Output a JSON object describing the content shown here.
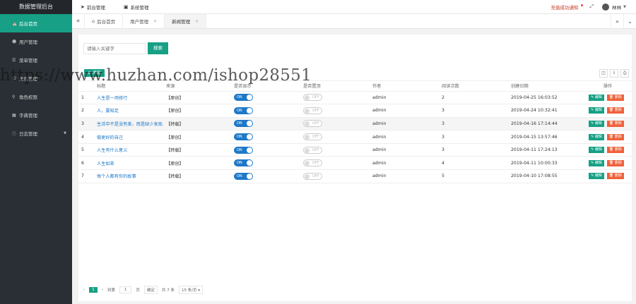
{
  "app": {
    "title": "数据管理后台"
  },
  "sidebar": {
    "items": [
      {
        "icon": "home-icon",
        "label": "后台首页",
        "active": true
      },
      {
        "icon": "users-icon",
        "label": "用户管理"
      },
      {
        "icon": "list-icon",
        "label": "菜单管理"
      },
      {
        "icon": "user-icon",
        "label": "角色管理"
      },
      {
        "icon": "key-icon",
        "label": "角色权限"
      },
      {
        "icon": "grid-icon",
        "label": "字典管理"
      },
      {
        "icon": "info-icon",
        "label": "日志管理",
        "has_caret": true
      }
    ]
  },
  "topbar": {
    "links": [
      {
        "icon": "send-icon",
        "label": "前台管理"
      },
      {
        "icon": "monitor-icon",
        "label": "系统管理"
      }
    ],
    "notice": "充值成功通知",
    "username": "林林"
  },
  "tabs": {
    "items": [
      {
        "label": "后台首页",
        "home": true
      },
      {
        "label": "用户管理"
      },
      {
        "label": "新闻管理",
        "active": true
      }
    ]
  },
  "search": {
    "placeholder": "请输入关键字",
    "button": "搜索"
  },
  "toolbar": {
    "add_label": "添加"
  },
  "table": {
    "headers": [
      "",
      "标题",
      "来源",
      "是否显示",
      "是否置顶",
      "作者",
      "阅读次数",
      "创建日期",
      "操作"
    ],
    "rows": [
      {
        "index": "1",
        "title": "人生是一场修行",
        "source": "【原创】",
        "show": "ON",
        "top": "OFF",
        "author": "admin",
        "views": "2",
        "date": "2019-04-25 16:03:52"
      },
      {
        "index": "2",
        "title": "人，要知足",
        "source": "【原创】",
        "show": "ON",
        "top": "OFF",
        "author": "admin",
        "views": "3",
        "date": "2019-04-24 10:32:41"
      },
      {
        "index": "3",
        "title": "生活中不是没有美，而是缺少发现…",
        "source": "【转载】",
        "show": "ON",
        "top": "OFF",
        "author": "admin",
        "views": "3",
        "date": "2019-04-16 17:14:44"
      },
      {
        "index": "4",
        "title": "做更好的自己",
        "source": "【原创】",
        "show": "ON",
        "top": "OFF",
        "author": "admin",
        "views": "3",
        "date": "2019-04-15 13:57:46"
      },
      {
        "index": "5",
        "title": "人生有什么意义",
        "source": "【转载】",
        "show": "ON",
        "top": "OFF",
        "author": "admin",
        "views": "3",
        "date": "2019-04-11 17:24:13"
      },
      {
        "index": "6",
        "title": "人生如茶",
        "source": "【原创】",
        "show": "ON",
        "top": "OFF",
        "author": "admin",
        "views": "4",
        "date": "2019-04-11 10:00:33"
      },
      {
        "index": "7",
        "title": "每个人都有你的故事",
        "source": "【转载】",
        "show": "ON",
        "top": "OFF",
        "author": "admin",
        "views": "5",
        "date": "2019-04-10 17:08:55"
      }
    ],
    "edit_label": "编辑",
    "delete_label": "删除"
  },
  "pager": {
    "current": "1",
    "goto_label": "到第",
    "goto_value": "1",
    "page_unit": "页",
    "confirm": "确定",
    "total": "共 7 条",
    "page_size": "15 条/页"
  },
  "watermark": "https://www.huzhan.com/ishop28551",
  "colors": {
    "sidebar": "#2a2f35",
    "accent": "#17a085",
    "link": "#1e78c8",
    "danger": "#f0613a"
  }
}
